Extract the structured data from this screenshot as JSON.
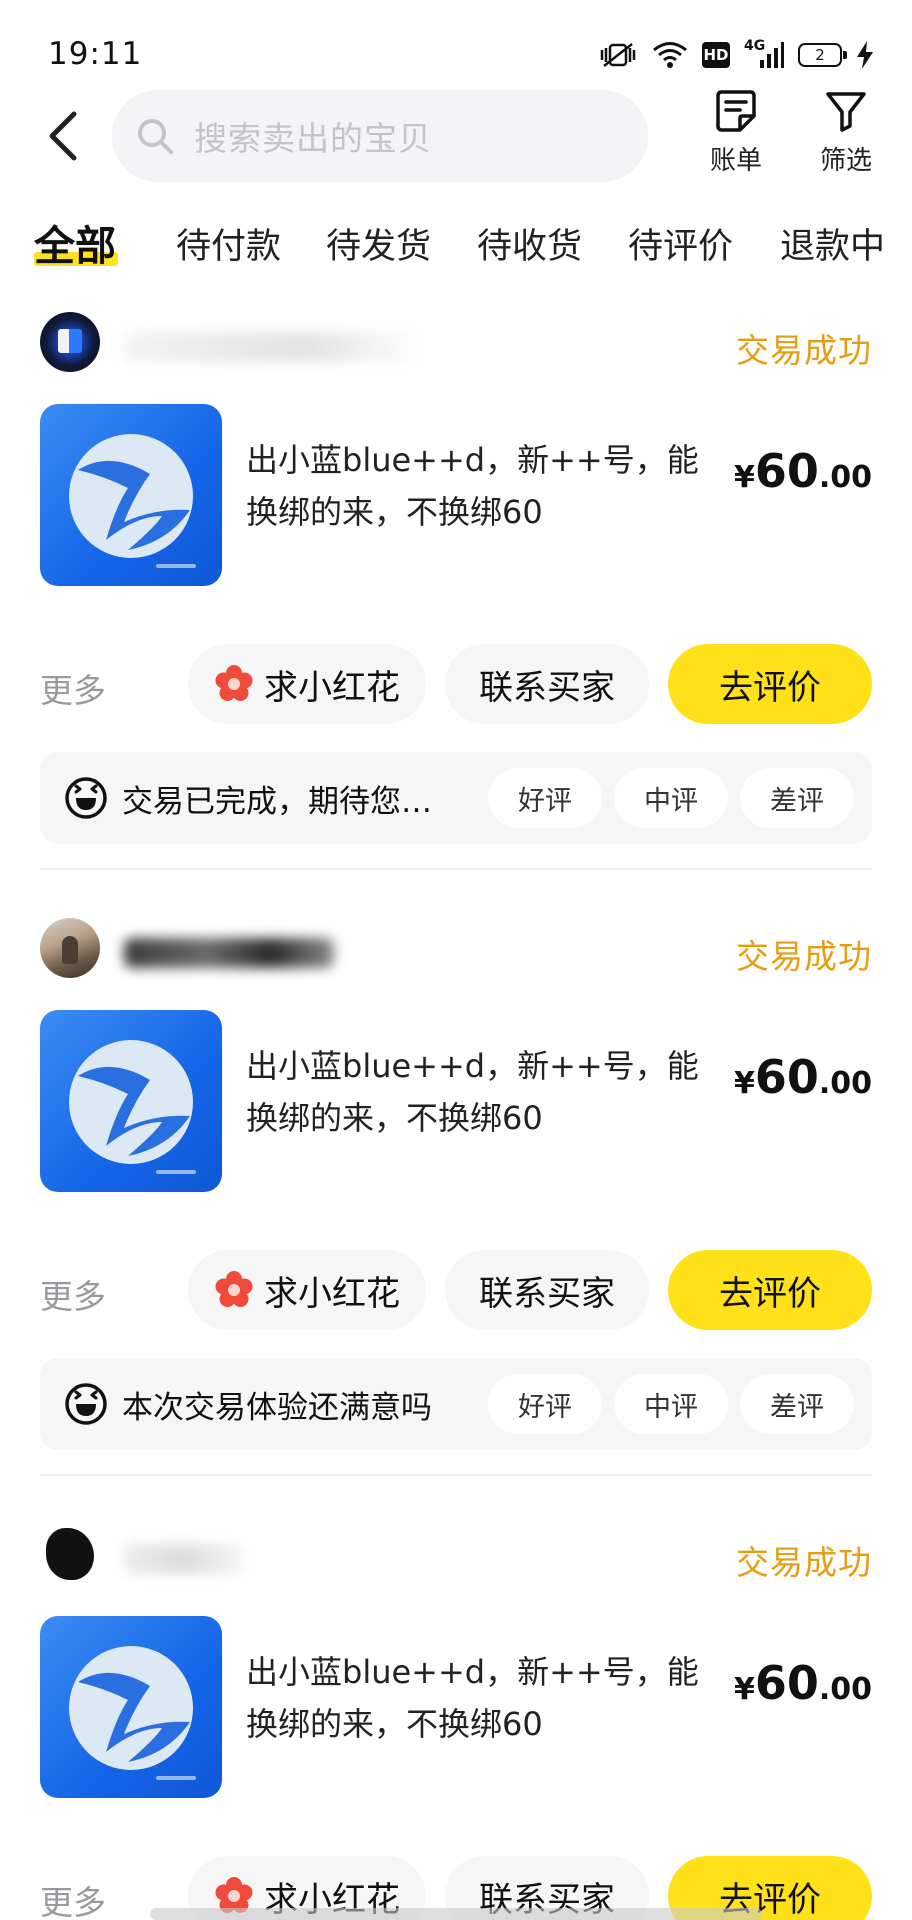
{
  "status_bar": {
    "time": "19:11",
    "hd": "HD",
    "network": "4G",
    "battery": "2"
  },
  "header": {
    "search_placeholder": "搜索卖出的宝贝",
    "bill_label": "账单",
    "filter_label": "筛选"
  },
  "tabs": [
    {
      "label": "全部",
      "active": true
    },
    {
      "label": "待付款"
    },
    {
      "label": "待发货"
    },
    {
      "label": "待收货"
    },
    {
      "label": "待评价"
    },
    {
      "label": "退款中"
    }
  ],
  "orders": [
    {
      "status": "交易成功",
      "title": "出小蓝blue++d，新++号，能换绑的来，不换绑60",
      "price": {
        "currency": "¥",
        "integer": "60",
        "decimal": ".00"
      },
      "more_label": "更多",
      "flower_label": "求小红花",
      "contact_label": "联系买家",
      "review_label": "去评价",
      "rating_prompt": "交易已完成，期待您…",
      "rating_options": [
        "好评",
        "中评",
        "差评"
      ]
    },
    {
      "status": "交易成功",
      "title": "出小蓝blue++d，新++号，能换绑的来，不换绑60",
      "price": {
        "currency": "¥",
        "integer": "60",
        "decimal": ".00"
      },
      "more_label": "更多",
      "flower_label": "求小红花",
      "contact_label": "联系买家",
      "review_label": "去评价",
      "rating_prompt": "本次交易体验还满意吗",
      "rating_options": [
        "好评",
        "中评",
        "差评"
      ]
    },
    {
      "status": "交易成功",
      "title": "出小蓝blue++d，新++号，能换绑的来，不换绑60",
      "price": {
        "currency": "¥",
        "integer": "60",
        "decimal": ".00"
      },
      "more_label": "更多",
      "flower_label": "求小红花",
      "contact_label": "联系买家",
      "review_label": "去评价"
    }
  ],
  "colors": {
    "accent_yellow": "#ffe11a",
    "status_orange": "#e89c12",
    "muted_gray": "#9a9a9e",
    "flower_red": "#f04b3a"
  },
  "icons": [
    "back-arrow-icon",
    "search-icon",
    "bill-icon",
    "filter-icon",
    "flower-icon",
    "grinning-face-icon",
    "app-logo-icon"
  ]
}
